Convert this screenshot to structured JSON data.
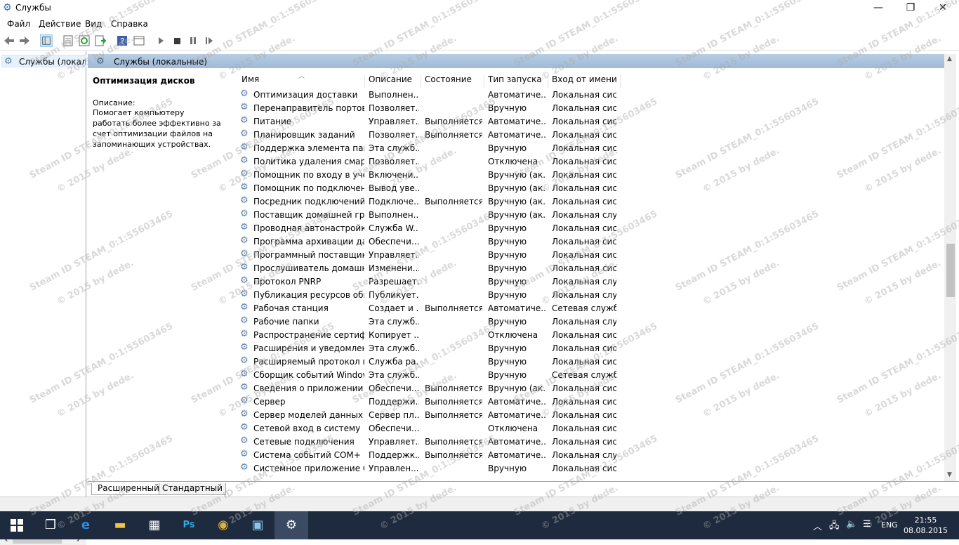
{
  "window": {
    "title": "Службы",
    "minimize_glyph": "—",
    "maximize_glyph": "❐",
    "close_glyph": "✕"
  },
  "menu": [
    "Файл",
    "Действие",
    "Вид",
    "Справка"
  ],
  "tree": {
    "root_label": "Службы (локалы"
  },
  "header": {
    "title": "Службы (локальные)"
  },
  "description": {
    "title": "Оптимизация дисков",
    "label": "Описание:",
    "text": "Помогает компьютеру работать более эффективно за счет оптимизации файлов на запоминающих устройствах."
  },
  "columns": {
    "name": "Имя",
    "desc": "Описание",
    "state": "Состояние",
    "start": "Тип запуска",
    "logon": "Вход от имени"
  },
  "rows": [
    {
      "name": "Оптимизация доставки",
      "desc": "Выполнен...",
      "state": "",
      "start": "Автоматиче...",
      "logon": "Локальная сис..."
    },
    {
      "name": "Перенаправитель портов ...",
      "desc": "Позволяет...",
      "state": "",
      "start": "Вручную",
      "logon": "Локальная сис..."
    },
    {
      "name": "Питание",
      "desc": "Управляет...",
      "state": "Выполняется",
      "start": "Автоматиче...",
      "logon": "Локальная сис..."
    },
    {
      "name": "Планировщик заданий",
      "desc": "Позволяет...",
      "state": "Выполняется",
      "start": "Автоматиче...",
      "logon": "Локальная сис..."
    },
    {
      "name": "Поддержка элемента пане...",
      "desc": "Эта служб...",
      "state": "",
      "start": "Вручную",
      "logon": "Локальная сис..."
    },
    {
      "name": "Политика удаления смарт...",
      "desc": "Позволяет...",
      "state": "",
      "start": "Отключена",
      "logon": "Локальная сис..."
    },
    {
      "name": "Помощник по входу в уче...",
      "desc": "Включени...",
      "state": "",
      "start": "Вручную (ак...",
      "logon": "Локальная сис..."
    },
    {
      "name": "Помощник по подключен...",
      "desc": "Вывод уве...",
      "state": "",
      "start": "Вручную (ак...",
      "logon": "Локальная сис..."
    },
    {
      "name": "Посредник подключений ...",
      "desc": "Подключе...",
      "state": "Выполняется",
      "start": "Вручную (ак...",
      "logon": "Локальная сис..."
    },
    {
      "name": "Поставщик домашней гру...",
      "desc": "Выполнен...",
      "state": "",
      "start": "Вручную (ак...",
      "logon": "Локальная слу..."
    },
    {
      "name": "Проводная автонастройка",
      "desc": "Служба W...",
      "state": "",
      "start": "Вручную",
      "logon": "Локальная сис..."
    },
    {
      "name": "Программа архивации да...",
      "desc": "Обеспечи...",
      "state": "",
      "start": "Вручную",
      "logon": "Локальная сис..."
    },
    {
      "name": "Программный поставщик...",
      "desc": "Управляет...",
      "state": "",
      "start": "Вручную",
      "logon": "Локальная сис..."
    },
    {
      "name": "Прослушиватель домашн...",
      "desc": "Изменени...",
      "state": "",
      "start": "Вручную",
      "logon": "Локальная сис..."
    },
    {
      "name": "Протокол PNRP",
      "desc": "Разрешает...",
      "state": "",
      "start": "Вручную",
      "logon": "Локальная слу..."
    },
    {
      "name": "Публикация ресурсов обн...",
      "desc": "Публикует...",
      "state": "",
      "start": "Вручную",
      "logon": "Локальная слу..."
    },
    {
      "name": "Рабочая станция",
      "desc": "Создает и ...",
      "state": "Выполняется",
      "start": "Автоматиче...",
      "logon": "Сетевая служба"
    },
    {
      "name": "Рабочие папки",
      "desc": "Эта служб...",
      "state": "",
      "start": "Вручную",
      "logon": "Локальная слу..."
    },
    {
      "name": "Распространение сертифи...",
      "desc": "Копирует ...",
      "state": "",
      "start": "Отключена",
      "logon": "Локальная сис..."
    },
    {
      "name": "Расширения и уведомлен...",
      "desc": "Эта служб...",
      "state": "",
      "start": "Вручную",
      "logon": "Локальная сис..."
    },
    {
      "name": "Расширяемый протокол п...",
      "desc": "Служба ра...",
      "state": "",
      "start": "Вручную",
      "logon": "Локальная сис..."
    },
    {
      "name": "Сборщик событий Windows",
      "desc": "Эта служб...",
      "state": "",
      "start": "Вручную",
      "logon": "Сетевая служба"
    },
    {
      "name": "Сведения о приложении",
      "desc": "Обеспечи...",
      "state": "Выполняется",
      "start": "Вручную (ак...",
      "logon": "Локальная сис..."
    },
    {
      "name": "Сервер",
      "desc": "Поддержи...",
      "state": "Выполняется",
      "start": "Автоматиче...",
      "logon": "Локальная сис..."
    },
    {
      "name": "Сервер моделей данных п...",
      "desc": "Сервер пл...",
      "state": "Выполняется",
      "start": "Автоматиче...",
      "logon": "Локальная сис..."
    },
    {
      "name": "Сетевой вход в систему",
      "desc": "Обеспечи...",
      "state": "",
      "start": "Отключена",
      "logon": "Локальная сис..."
    },
    {
      "name": "Сетевые подключения",
      "desc": "Управляет...",
      "state": "Выполняется",
      "start": "Автоматиче...",
      "logon": "Локальная сис..."
    },
    {
      "name": "Система событий COM+",
      "desc": "Поддержк...",
      "state": "Выполняется",
      "start": "Автоматиче...",
      "logon": "Локальная слу..."
    },
    {
      "name": "Системное приложение C...",
      "desc": "Управлен...",
      "state": "",
      "start": "Вручную",
      "logon": "Локальная сис..."
    }
  ],
  "tabs": {
    "extended": "Расширенный",
    "standard": "Стандартный"
  },
  "taskbar": {
    "lang": "ENG",
    "time": "21:55",
    "date": "08.08.2015"
  },
  "watermark": {
    "line1": "Steam ID  STEAM_0:1:55603465",
    "line2": "© 2015 by dede."
  },
  "colors": {
    "header_band": "#b7cde3",
    "taskbar": "#1e2a3d",
    "selection": "#e5f1fb"
  }
}
